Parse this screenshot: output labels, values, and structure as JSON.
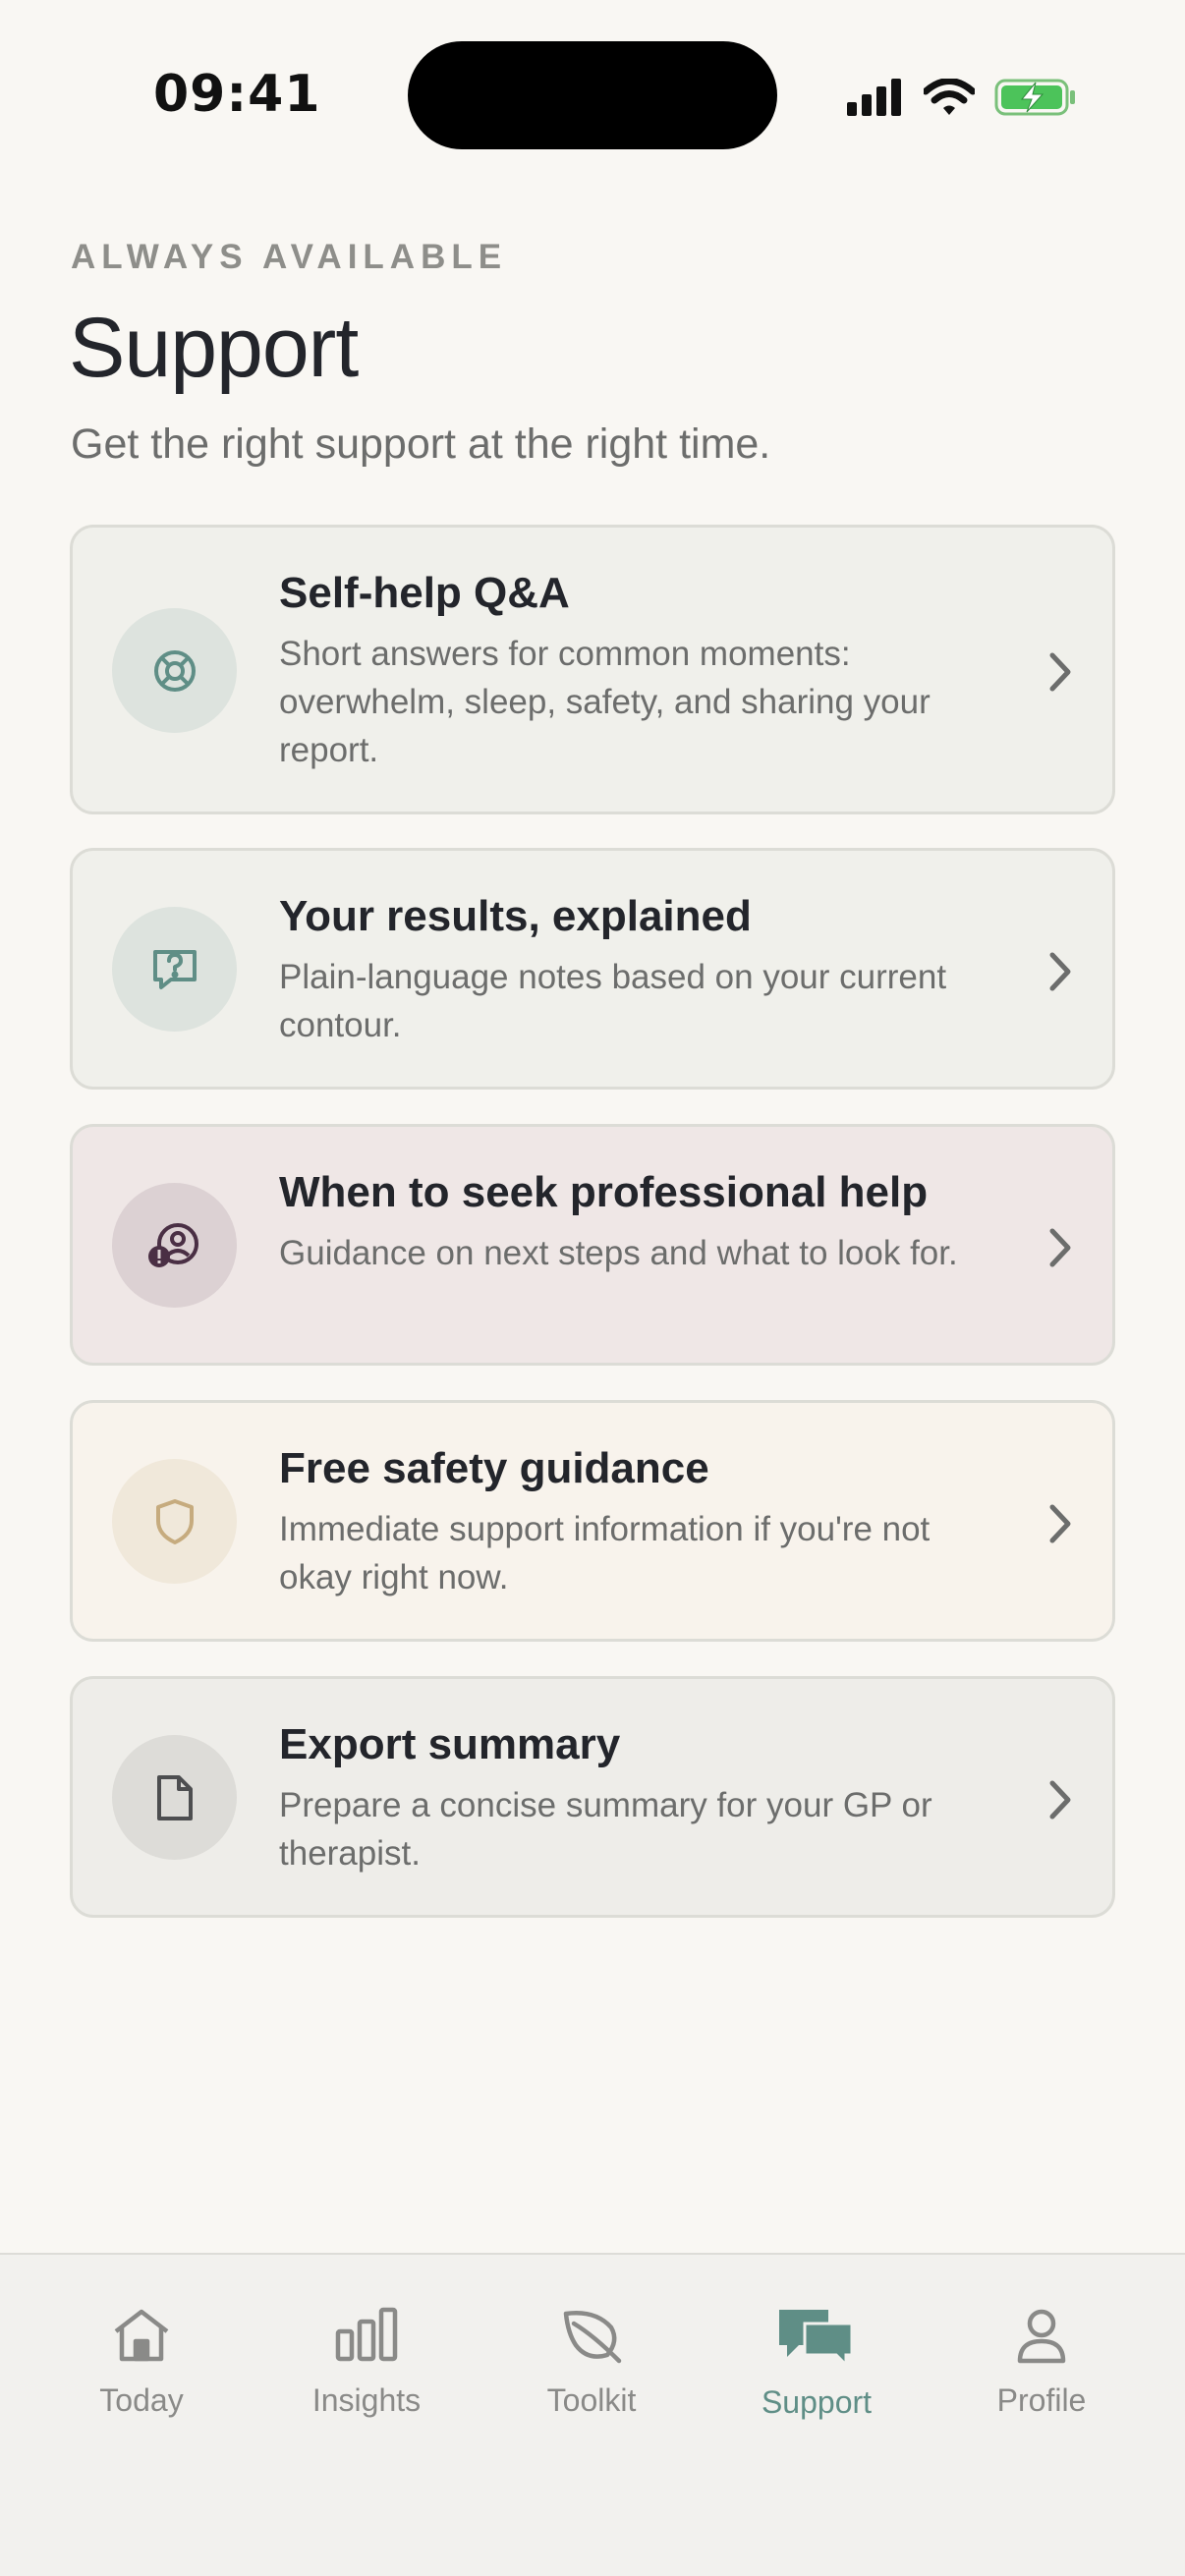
{
  "status_bar": {
    "time": "09:41"
  },
  "header": {
    "eyebrow": "ALWAYS AVAILABLE",
    "title": "Support",
    "subtitle": "Get the right support at the right time."
  },
  "cards": [
    {
      "title": "Self-help Q&A",
      "description": "Short answers for common moments: overwhelm, sleep, safety, and sharing your report.",
      "icon": "lifebuoy-icon"
    },
    {
      "title": "Your results, explained",
      "description": "Plain-language notes based on your current contour.",
      "icon": "question-bubble-icon"
    },
    {
      "title": "When to seek professional help",
      "description": "Guidance on next steps and what to look for.",
      "icon": "professional-help-icon"
    },
    {
      "title": "Free safety guidance",
      "description": "Immediate support information if you're not okay right now.",
      "icon": "shield-icon"
    },
    {
      "title": "Export summary",
      "description": "Prepare a concise summary for your GP or therapist.",
      "icon": "document-icon"
    }
  ],
  "tabs": [
    {
      "label": "Today",
      "icon": "home-icon"
    },
    {
      "label": "Insights",
      "icon": "bar-chart-icon"
    },
    {
      "label": "Toolkit",
      "icon": "leaf-icon"
    },
    {
      "label": "Support",
      "icon": "chat-bubbles-icon",
      "active": true
    },
    {
      "label": "Profile",
      "icon": "person-icon"
    }
  ],
  "colors": {
    "background": "#f9f7f3",
    "accent": "#5f8e86",
    "card_neutral": "#f0f0eb",
    "card_mauve": "#efe7e6",
    "card_cream": "#f8f3ec",
    "card_grey": "#eeede9"
  }
}
